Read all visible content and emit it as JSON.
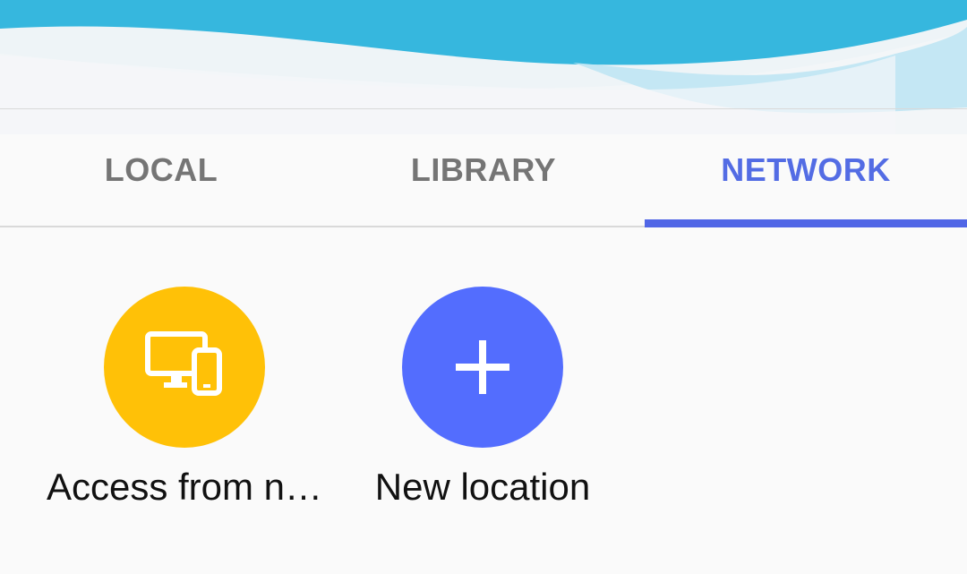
{
  "tabs": [
    {
      "label": "LOCAL",
      "active": false
    },
    {
      "label": "LIBRARY",
      "active": false
    },
    {
      "label": "NETWORK",
      "active": true
    }
  ],
  "network_items": [
    {
      "label": "Access from n…",
      "icon": "devices-icon",
      "color": "#ffc107"
    },
    {
      "label": "New location",
      "icon": "plus-icon",
      "color": "#536dfe"
    }
  ],
  "colors": {
    "accent": "#536ce4",
    "header_wave": "#36b7de"
  }
}
